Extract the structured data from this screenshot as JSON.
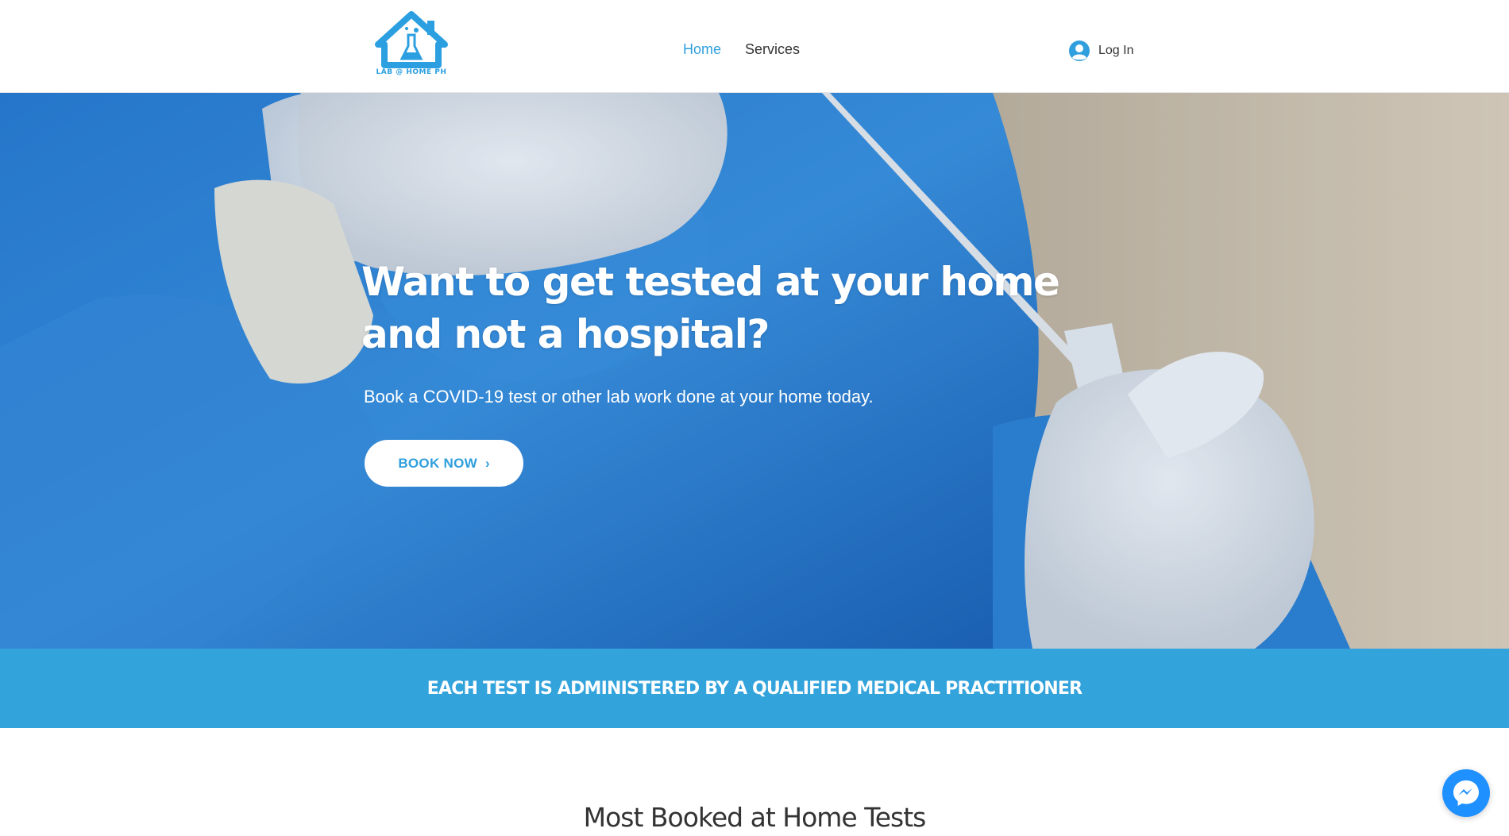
{
  "header": {
    "logo_text": "LAB @ HOME PH",
    "nav": [
      {
        "label": "Home",
        "active": true
      },
      {
        "label": "Services",
        "active": false
      }
    ],
    "login_label": "Log In"
  },
  "hero": {
    "title": "Want to get tested at your home and not a hospital?",
    "subtitle": "Book a COVID-19 test or other lab work done at your home today.",
    "cta_label": "BOOK NOW"
  },
  "banner": {
    "text": "EACH TEST IS ADMINISTERED BY A QUALIFIED MEDICAL PRACTITIONER"
  },
  "section": {
    "title": "Most Booked at Home Tests"
  },
  "icons": {
    "logo": "house-flask-icon",
    "login": "user-avatar-icon",
    "cta_chevron": "chevron-right-icon",
    "chat": "messenger-icon"
  },
  "colors": {
    "accent": "#2f9fdd",
    "banner": "#33a3dc",
    "text": "#333333"
  }
}
